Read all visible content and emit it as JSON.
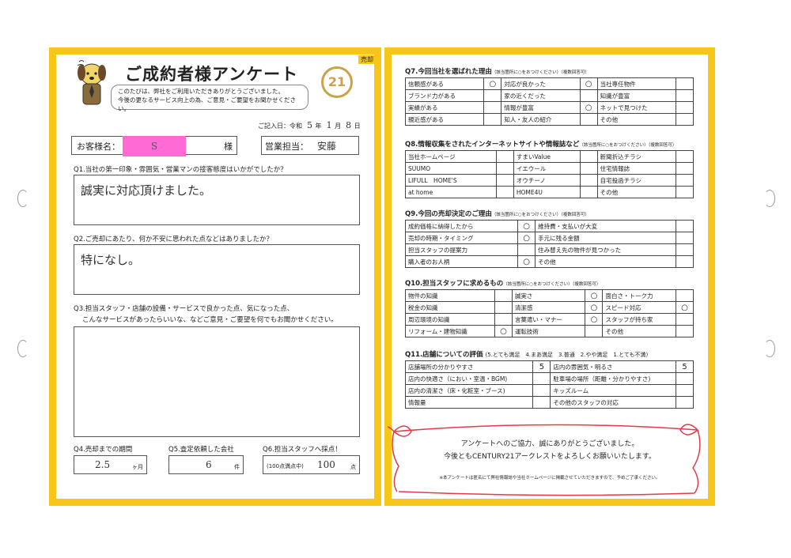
{
  "header": {
    "title": "ご成約者様アンケート",
    "tag": "売却",
    "intro_line1": "このたびは、弊社をご利用いただきありがとうございました。",
    "intro_line2": "今後の更なるサービス向上の為、ご意見・ご要望をお聞かせください。",
    "logo_text": "21"
  },
  "date": {
    "label": "ご記入日：令和",
    "year": "5",
    "year_unit": "年",
    "month": "1",
    "month_unit": "月",
    "day": "8",
    "day_unit": "日"
  },
  "customer": {
    "label": "お客様名：",
    "value": "S",
    "suffix": "様"
  },
  "staff": {
    "label": "営業担当：",
    "value": "安藤"
  },
  "q1": {
    "question": "Q1.当社の第一印象・雰囲気・営業マンの接客態度はいかがでしたか？",
    "answer": "誠実に対応頂けました。"
  },
  "q2": {
    "question": "Q2.ご売却にあたり、何か不安に思われた点などはありましたか？",
    "answer": "特になし。"
  },
  "q3": {
    "question_line1": "Q3.担当スタッフ・店舗の設備・サービスで良かった点、気になった点、",
    "question_line2": "こんなサービスがあったらいいな、などご意見・ご要望を何でもお聞かせください。",
    "answer": ""
  },
  "q4": {
    "label": "Q4.売却までの期間",
    "value": "2.5",
    "unit": "ヶ月"
  },
  "q5": {
    "label": "Q5.査定依頼した会社",
    "value": "6",
    "unit": "件"
  },
  "q6": {
    "label": "Q6.担当スタッフへ採点！",
    "prefix": "(100点満点中)",
    "value": "100",
    "unit": "点"
  },
  "q7": {
    "title": "Q7.今回当社を選ばれた理由",
    "note": "（該当箇所に○をおつけください）（複数回答可）",
    "rows": [
      [
        {
          "t": "信頼感がある",
          "m": "○"
        },
        {
          "t": "対応が良かった",
          "m": "○"
        },
        {
          "t": "当社専任物件",
          "m": ""
        }
      ],
      [
        {
          "t": "ブランド力がある",
          "m": ""
        },
        {
          "t": "家の近くだった",
          "m": ""
        },
        {
          "t": "知識が豊富",
          "m": ""
        }
      ],
      [
        {
          "t": "実績がある",
          "m": ""
        },
        {
          "t": "情報が豊富",
          "m": "○"
        },
        {
          "t": "ネットで見つけた",
          "m": ""
        }
      ],
      [
        {
          "t": "親近感がある",
          "m": ""
        },
        {
          "t": "知人・友人の紹介",
          "m": ""
        },
        {
          "t": "その他",
          "m": ""
        }
      ]
    ]
  },
  "q8": {
    "title": "Q8.情報収集をされたインターネットサイトや情報誌など",
    "note": "（該当箇所に○をおつけください）（複数回答可）",
    "rows": [
      [
        {
          "t": "当社ホームページ",
          "m": ""
        },
        {
          "t": "すまいValue",
          "m": ""
        },
        {
          "t": "新聞折込チラシ",
          "m": ""
        }
      ],
      [
        {
          "t": "SUUMO",
          "m": ""
        },
        {
          "t": "イエウール",
          "m": ""
        },
        {
          "t": "住宅情報誌",
          "m": ""
        }
      ],
      [
        {
          "t": "LIFULL　HOME'S",
          "m": ""
        },
        {
          "t": "オウチーノ",
          "m": ""
        },
        {
          "t": "自宅投函チラシ",
          "m": ""
        }
      ],
      [
        {
          "t": "at home",
          "m": ""
        },
        {
          "t": "HOME4U",
          "m": ""
        },
        {
          "t": "その他",
          "m": ""
        }
      ]
    ]
  },
  "q9": {
    "title": "Q9.今回の売却決定のご理由",
    "note": "（該当箇所に○をおつけください）（複数回答可）",
    "rows": [
      [
        {
          "t": "成約価格に納得したから",
          "m": "○"
        },
        {
          "t": "維持費・支払いが大変",
          "m": ""
        }
      ],
      [
        {
          "t": "売却の時期・タイミング",
          "m": "○"
        },
        {
          "t": "手元に残る金額",
          "m": ""
        }
      ],
      [
        {
          "t": "担当スタッフの提案力",
          "m": ""
        },
        {
          "t": "住み替え先の物件が見つかった",
          "m": ""
        }
      ],
      [
        {
          "t": "購入者のお人柄",
          "m": "○"
        },
        {
          "t": "その他",
          "m": ""
        }
      ]
    ]
  },
  "q10": {
    "title": "Q10.担当スタッフに求めるもの",
    "note": "（該当箇所に○をおつけください）（複数回答可）",
    "rows": [
      [
        {
          "t": "物件の知識",
          "m": ""
        },
        {
          "t": "誠実さ",
          "m": "○"
        },
        {
          "t": "面白さ・トーク力",
          "m": ""
        }
      ],
      [
        {
          "t": "税金の知識",
          "m": ""
        },
        {
          "t": "清潔感",
          "m": "○"
        },
        {
          "t": "スピード対応",
          "m": "○"
        }
      ],
      [
        {
          "t": "周辺環境の知識",
          "m": ""
        },
        {
          "t": "言葉遣い・マナー",
          "m": "○"
        },
        {
          "t": "スタッフが持ち家",
          "m": ""
        }
      ],
      [
        {
          "t": "リフォーム・建物知識",
          "m": "○"
        },
        {
          "t": "運転技術",
          "m": ""
        },
        {
          "t": "その他",
          "m": ""
        }
      ]
    ]
  },
  "q11": {
    "title": "Q11.店舗についての評価",
    "scale": "(5.とても満足　4.まあ満足　3.普通　2.やや満足　1.とても不満)",
    "rows": [
      [
        {
          "t": "店舗場所の分かりやすさ",
          "m": "5"
        },
        {
          "t": "店内の雰囲気・明るさ",
          "m": "5"
        }
      ],
      [
        {
          "t": "店内の快適さ（におい・室温・BGM)",
          "m": ""
        },
        {
          "t": "駐車場の場所（距離・分かりやすさ)",
          "m": ""
        }
      ],
      [
        {
          "t": "店内の清潔さ（床・化粧室・ブース)",
          "m": ""
        },
        {
          "t": "キッズルーム",
          "m": ""
        }
      ],
      [
        {
          "t": "情報量",
          "m": ""
        },
        {
          "t": "その他のスタッフの対応",
          "m": ""
        }
      ]
    ]
  },
  "footer": {
    "thanks_line1": "アンケートへのご協力、誠にありがとうございました。",
    "thanks_line2": "今後ともCENTURY21アークレストをよろしくお願いいたします。",
    "note": "※本アンケートは匿名にて弊社情報誌や当社ホームページに掲載させていただきますので、予めご了承ください。"
  },
  "colors": {
    "frame": "#f6c61a",
    "highlight": "#ff6ad5",
    "ribbon": "#e23b4a",
    "logo": "#c9a24a"
  }
}
